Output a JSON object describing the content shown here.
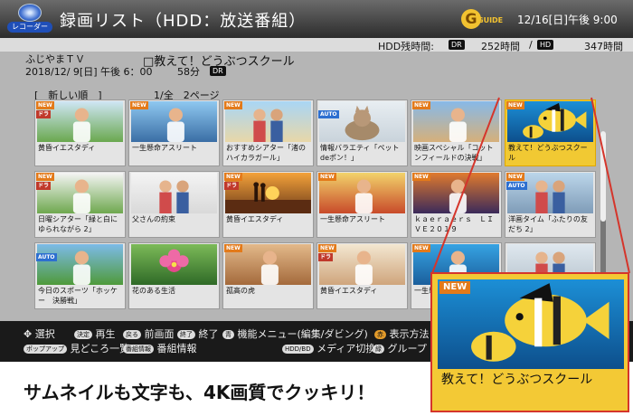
{
  "header": {
    "logo_label": "レコーダー",
    "title": "録画リスト（HDD：放送番組）",
    "guide_mark": "G",
    "guide_text": "GUIDE",
    "datetime": "12/16[日]午後 9:00"
  },
  "capacity": {
    "label": "HDD残時間:",
    "mode1": "DR",
    "value1": "252時間",
    "mode2": "HD",
    "value2": "347時間"
  },
  "info": {
    "channel": "ふじやまＴＶ",
    "program": "□教えて！どうぶつスクール",
    "date": "2018/12/ 9[日] 午後 6：00",
    "duration": "58分",
    "mode": "DR"
  },
  "list": {
    "sort": "[　新しい順　]",
    "page": "1/全　2ページ"
  },
  "grid": [
    {
      "caption": "黄昏イエスタディ",
      "new": true,
      "tag": "ドラ",
      "art": "a"
    },
    {
      "caption": "一生懸命アスリート",
      "new": true,
      "tag": "",
      "art": "b"
    },
    {
      "caption": "おすすめシアター「渚のハイカラガール」",
      "new": true,
      "tag": "",
      "art": "c"
    },
    {
      "caption": "情報バラエティ「ペットdeポン！」",
      "new": false,
      "tag": "AUTO",
      "art": "d"
    },
    {
      "caption": "映画スペシャル「コットンフィールドの決戦」",
      "new": true,
      "tag": "",
      "art": "e"
    },
    {
      "caption": "教えて！どうぶつスクール",
      "new": true,
      "tag": "",
      "art": "f"
    },
    {
      "caption": "日曜シアター「緑と白にゆられながら 2」",
      "new": true,
      "tag": "ドラ",
      "art": "g"
    },
    {
      "caption": "父さんの約束",
      "new": false,
      "tag": "",
      "art": "h"
    },
    {
      "caption": "黄昏イエスタディ",
      "new": true,
      "tag": "ドラ",
      "art": "i"
    },
    {
      "caption": "一生懸命アスリート",
      "new": true,
      "tag": "",
      "art": "j"
    },
    {
      "caption": "ｋａｅｒａｅｒｓ　ＬＩＶＥ２０１９",
      "new": true,
      "tag": "",
      "art": "k"
    },
    {
      "caption": "洋画タイム「ふたりの友だち 2」",
      "new": true,
      "tag": "AUTO",
      "art": "l"
    },
    {
      "caption": "今日のスポーツ「ホッケー　決勝戦」",
      "new": false,
      "tag": "AUTO",
      "art": "m"
    },
    {
      "caption": "花のある生活",
      "new": false,
      "tag": "",
      "art": "n"
    },
    {
      "caption": "孤高の虎",
      "new": true,
      "tag": "",
      "art": "o"
    },
    {
      "caption": "黄昏イエスタディ",
      "new": true,
      "tag": "ドラ",
      "art": "p"
    },
    {
      "caption": "一生懸命アスリート",
      "new": true,
      "tag": "",
      "art": "q"
    },
    {
      "caption": "",
      "new": false,
      "tag": "",
      "art": "r"
    }
  ],
  "tags": {
    "new": "NEW"
  },
  "help": {
    "select_icon": "✥",
    "select": "選択",
    "play_key": "決定",
    "play": "再生",
    "back_key": "戻る",
    "back": "前画面",
    "end_key": "終了",
    "end": "終了",
    "menu_key": "青",
    "menu": "機能メニュー(編集/ダビング)",
    "disp_key": "赤",
    "disp": "表示方法",
    "pop_key": "ポップアップ",
    "list": "見どころ一覧",
    "info_key": "番組情報",
    "info": "番組情報",
    "media_key": "HDD/BD",
    "media": "メディア切換",
    "group_key": "緑",
    "group": "グループ"
  },
  "zoom": {
    "new": "NEW",
    "caption": "教えて！どうぶつスクール"
  },
  "footer": "サムネイルも文字も、4K画質でクッキリ！"
}
